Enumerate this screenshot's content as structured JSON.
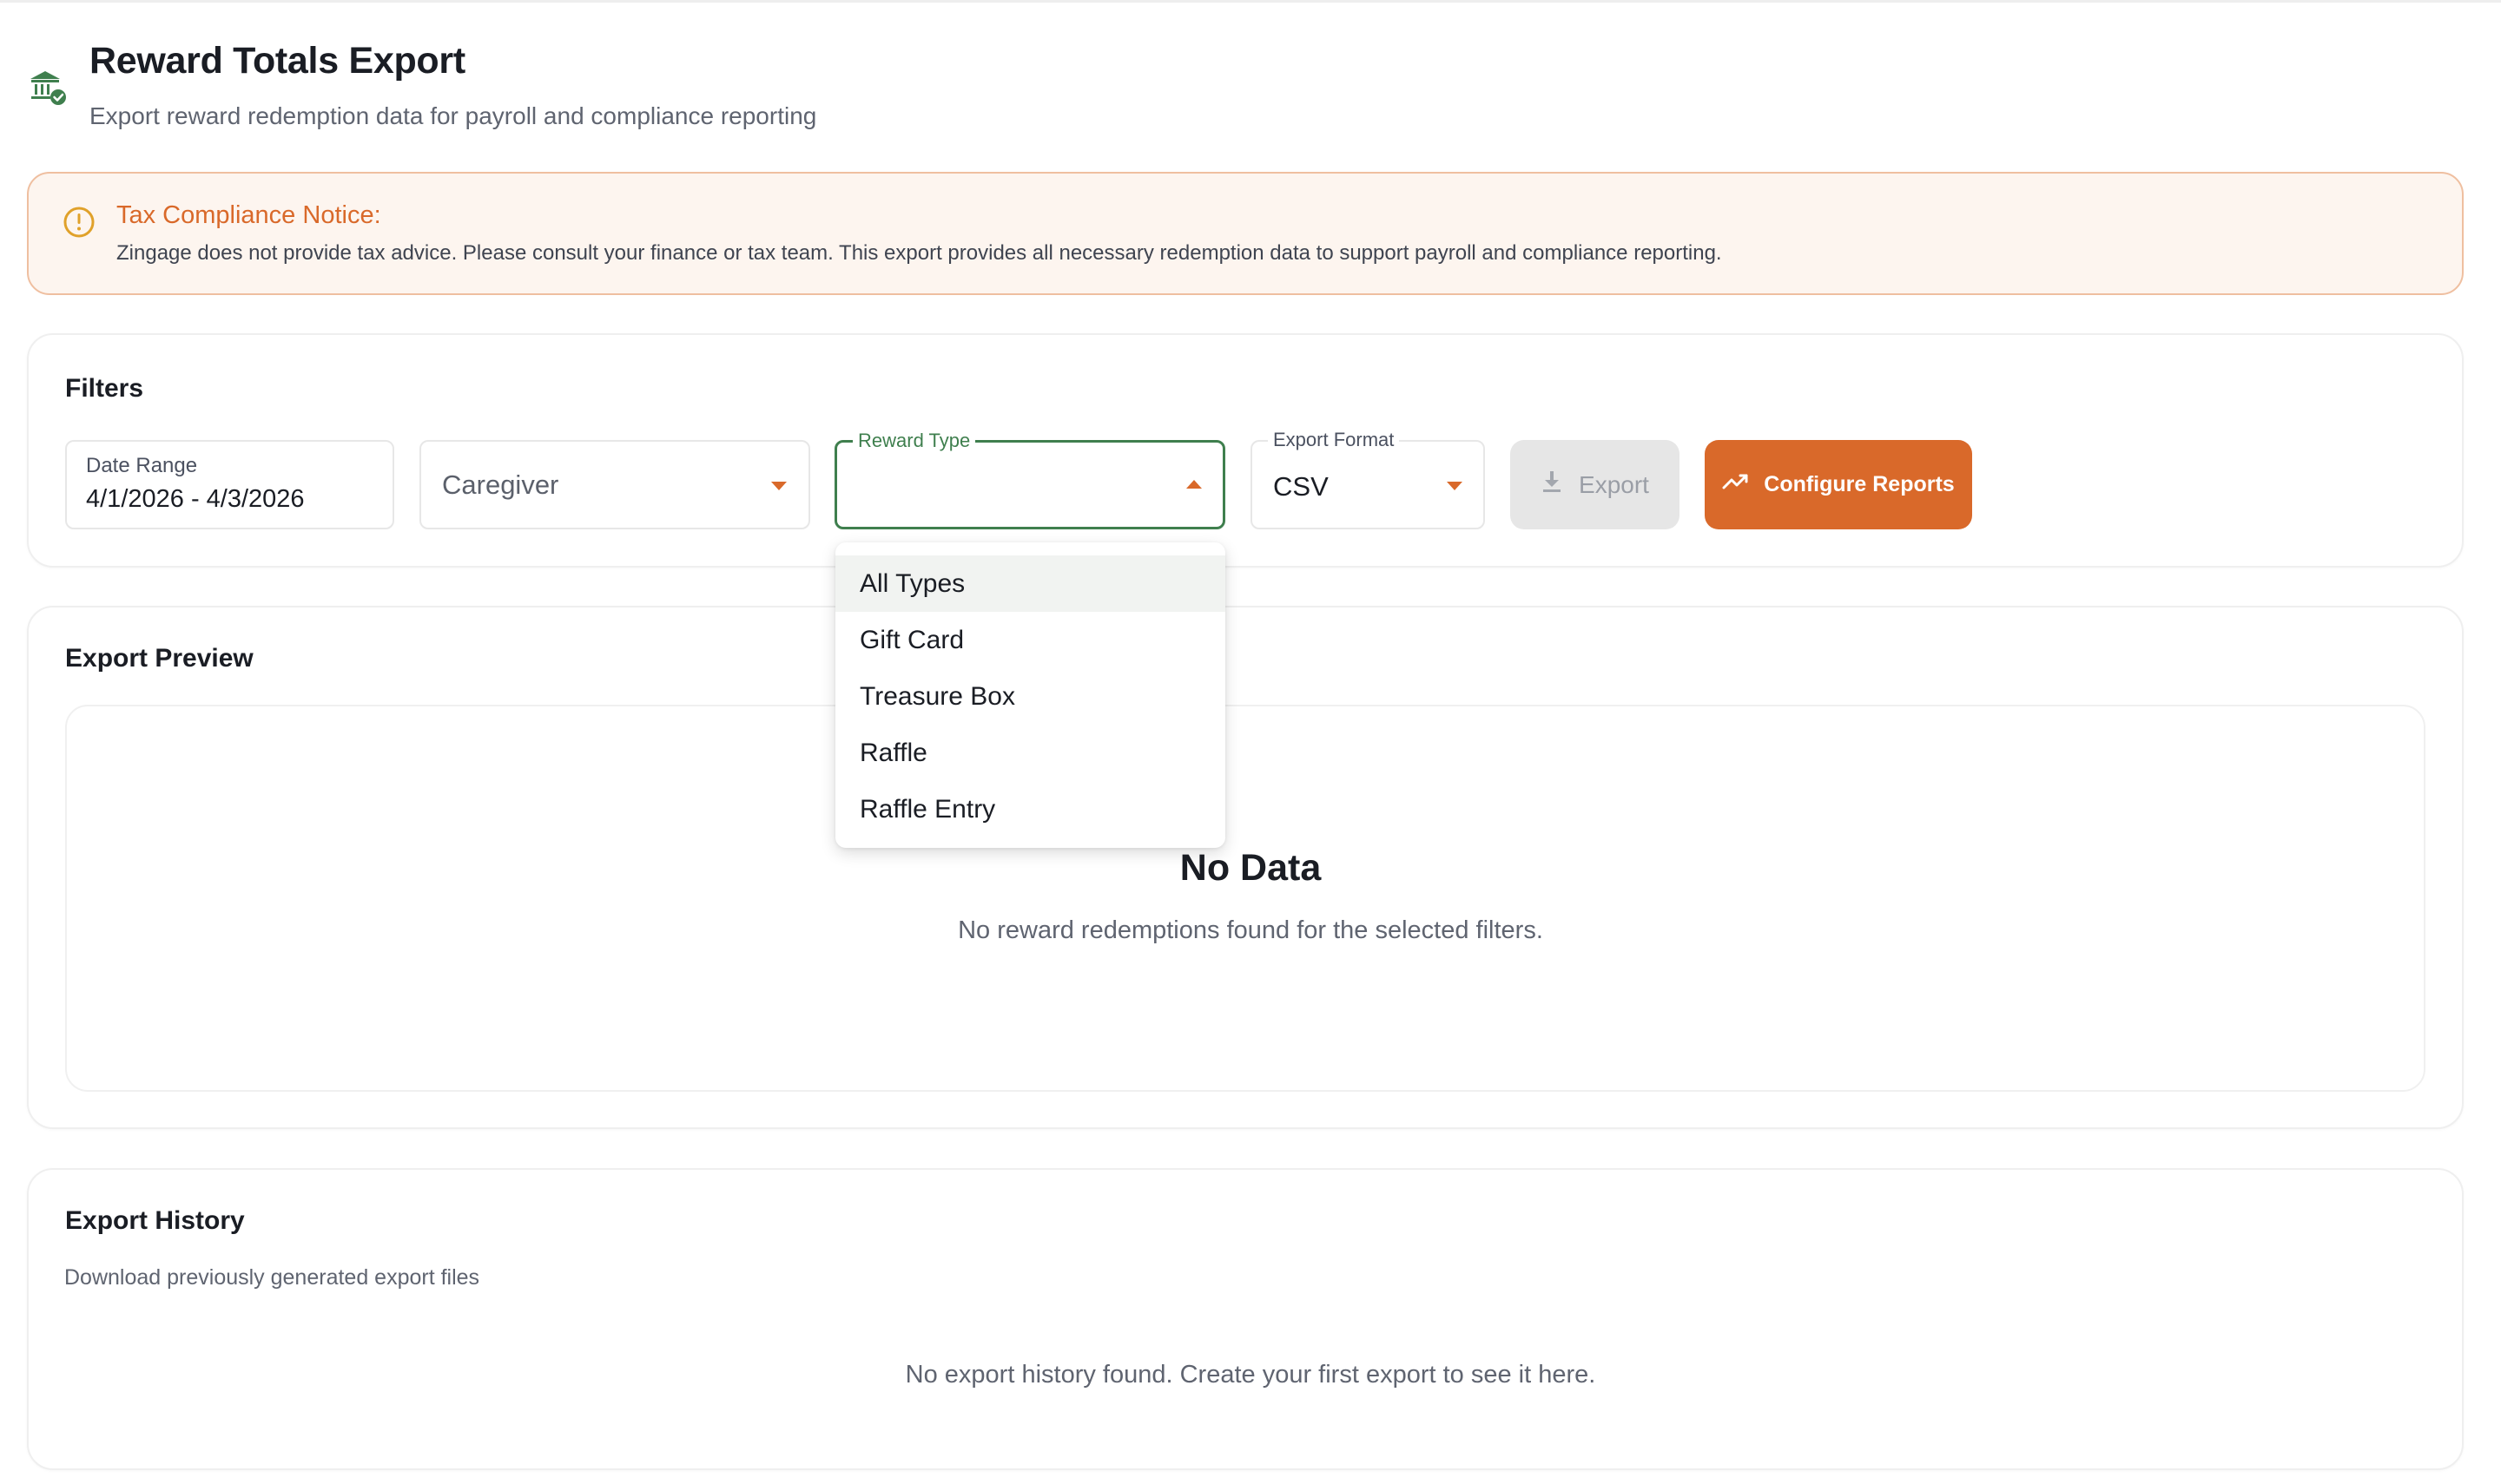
{
  "header": {
    "title": "Reward Totals Export",
    "subtitle": "Export reward redemption data for payroll and compliance reporting",
    "icon": "bank-shield-icon"
  },
  "notice": {
    "title": "Tax Compliance Notice:",
    "body": "Zingage does not provide tax advice. Please consult your finance or tax team. This export provides all necessary redemption data to support payroll and compliance reporting.",
    "icon": "alert-circle-icon"
  },
  "filters": {
    "title": "Filters",
    "date_range": {
      "label": "Date Range",
      "value": "4/1/2026 - 4/3/2026"
    },
    "caregiver": {
      "value": "Caregiver"
    },
    "reward_type": {
      "label": "Reward Type",
      "value": "",
      "options": [
        "All Types",
        "Gift Card",
        "Treasure Box",
        "Raffle",
        "Raffle Entry"
      ],
      "highlighted": "All Types"
    },
    "export_format": {
      "label": "Export Format",
      "value": "CSV"
    },
    "export_button": "Export",
    "configure_button": "Configure Reports"
  },
  "preview": {
    "title": "Export Preview",
    "empty_title": "No Data",
    "empty_text": "No reward redemptions found for the selected filters."
  },
  "history": {
    "title": "Export History",
    "subtitle": "Download previously generated export files",
    "empty_text": "No export history found. Create your first export to see it here."
  },
  "colors": {
    "accent": "#d9692a",
    "brand_green": "#3f7f4e",
    "notice_bg": "#fdf5ef",
    "notice_border": "#efbfa0"
  }
}
